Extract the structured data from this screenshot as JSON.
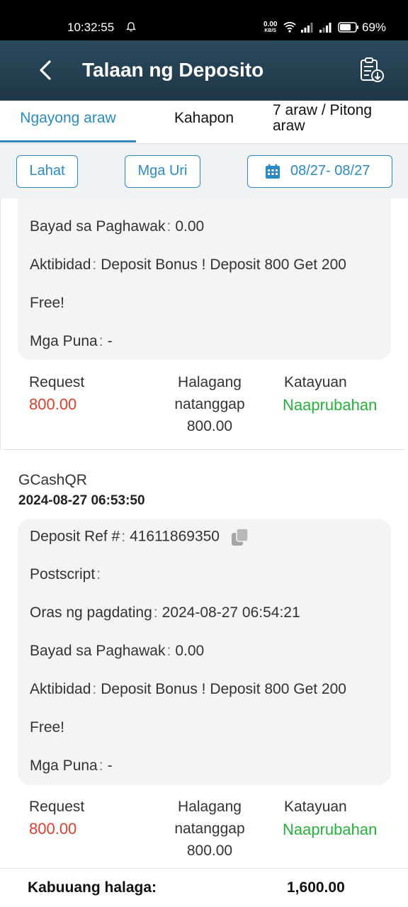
{
  "status_bar": {
    "time": "10:32:55",
    "net_speed_value": "0.00",
    "net_speed_unit": "KB/S",
    "battery": "69%",
    "icons": [
      "bell-icon",
      "wifi-icon",
      "signal-icon",
      "signal-icon",
      "battery-icon"
    ]
  },
  "header": {
    "title": "Talaan ng Deposito",
    "icons": [
      "back-icon",
      "export-clipboard-icon"
    ]
  },
  "tabs": [
    {
      "label": "Ngayong araw",
      "active": true
    },
    {
      "label": "Kahapon",
      "active": false
    },
    {
      "label": "7 araw / Pitong araw",
      "active": false
    }
  ],
  "filters": {
    "all_label": "Lahat",
    "types_label": "Mga Uri",
    "date_range": "08/27- 08/27"
  },
  "records": [
    {
      "fee_label": "Bayad sa Paghawak",
      "fee_value": "0.00",
      "activity_label": "Aktibidad",
      "activity_value_line1": "Deposit Bonus ! Deposit 800 Get 200",
      "activity_value_line2": "Free!",
      "remarks_label": "Mga Puna",
      "remarks_value": "-",
      "request_label": "Request",
      "request_value": "800.00",
      "received_label_line1": "Halagang",
      "received_label_line2": "natanggap",
      "received_value": "800.00",
      "status_label": "Katayuan",
      "status_value": "Naaprubahan"
    },
    {
      "method": "GCashQR",
      "datetime": "2024-08-27 06:53:50",
      "ref_label": "Deposit Ref #",
      "ref_value": "41611869350",
      "postscript_label": "Postscript",
      "arrival_label": "Oras ng pagdating",
      "arrival_value": "2024-08-27 06:54:21",
      "fee_label": "Bayad sa Paghawak",
      "fee_value": "0.00",
      "activity_label": "Aktibidad",
      "activity_value_line1": "Deposit Bonus ! Deposit 800 Get 200",
      "activity_value_line2": "Free!",
      "remarks_label": "Mga Puna",
      "remarks_value": "-",
      "request_label": "Request",
      "request_value": "800.00",
      "received_label_line1": "Halagang",
      "received_label_line2": "natanggap",
      "received_value": "800.00",
      "status_label": "Katayuan",
      "status_value": "Naaprubahan"
    }
  ],
  "separator": ":",
  "footer": {
    "total_label": "Kabuuang halaga:",
    "total_value": "1,600.00"
  },
  "colors": {
    "accent": "#2a8bc4",
    "header_bg": "#243f51",
    "amount_red": "#d8412f",
    "status_green": "#27b03a"
  }
}
